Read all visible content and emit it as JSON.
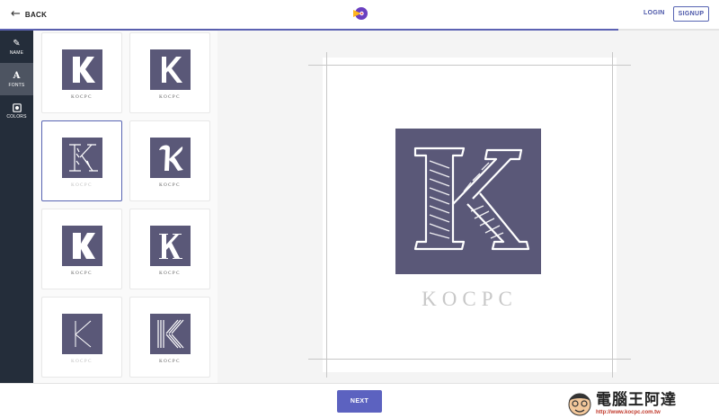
{
  "header": {
    "back_label": "BACK",
    "login_label": "LOGIN",
    "signup_label": "SIGNUP",
    "progress_fraction": 0.86,
    "brand_icon": "brand-logo-icon"
  },
  "nav": {
    "items": [
      {
        "label": "NAME",
        "icon": "edit-icon"
      },
      {
        "label": "FONTS",
        "icon": "font-a-icon"
      },
      {
        "label": "COLORS",
        "icon": "palette-icon"
      }
    ],
    "active_index": 1
  },
  "font_options": [
    {
      "letter": "K",
      "name": "KOCPC",
      "style": "bold-sans"
    },
    {
      "letter": "K",
      "name": "KOCPC",
      "style": "sans"
    },
    {
      "letter": "K",
      "name": "KOCPC",
      "style": "sketch-serif",
      "selected": true
    },
    {
      "letter": "K",
      "name": "KOCPC",
      "style": "script"
    },
    {
      "letter": "K",
      "name": "KOCPC",
      "style": "bold-sans"
    },
    {
      "letter": "K",
      "name": "KOCPC",
      "style": "serif"
    },
    {
      "letter": "K",
      "name": "KOCPC",
      "style": "thin"
    },
    {
      "letter": "K",
      "name": "KOCPC",
      "style": "striped"
    }
  ],
  "preview": {
    "letter": "K",
    "name": "KOCPC",
    "tile_color": "#5a5878",
    "name_color": "#c8c8c8"
  },
  "footer": {
    "next_label": "NEXT"
  },
  "watermark": {
    "title": "電腦王阿達",
    "url": "http://www.kocpc.com.tw"
  },
  "colors": {
    "accent": "#5c62c0",
    "nav_bg": "#242d3a",
    "tile": "#5a5878"
  }
}
